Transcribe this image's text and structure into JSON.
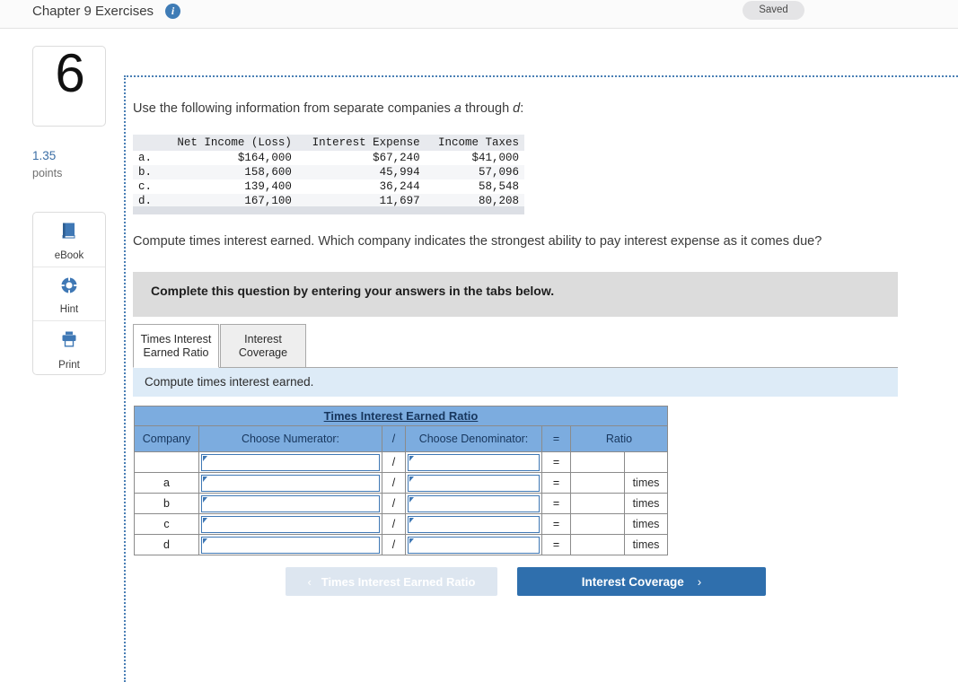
{
  "header": {
    "title": "Chapter 9 Exercises",
    "info_icon": "info-icon",
    "saved_label": "Saved"
  },
  "sidebar": {
    "question_number": "6",
    "points_value": "1.35",
    "points_label": "points",
    "tools": [
      {
        "label": "eBook",
        "icon": "ebook-icon"
      },
      {
        "label": "Hint",
        "icon": "life-preserver-icon"
      },
      {
        "label": "Print",
        "icon": "printer-icon"
      }
    ]
  },
  "content": {
    "intro_pre": "Use the following information from separate companies ",
    "intro_a": "a",
    "intro_mid": " through ",
    "intro_d": "d",
    "intro_post": ":",
    "prompt": "Compute times interest earned. Which company indicates the strongest ability to pay interest expense as it comes due?",
    "instruction": "Complete this question by entering your answers in the tabs below.",
    "subprompt": "Compute times interest earned."
  },
  "data_table": {
    "columns": [
      "",
      "Net Income (Loss)",
      "Interest Expense",
      "Income Taxes"
    ],
    "rows": [
      {
        "label": "a.",
        "net_income": "$164,000",
        "interest_expense": "$67,240",
        "income_taxes": "$41,000"
      },
      {
        "label": "b.",
        "net_income": "158,600",
        "interest_expense": "45,994",
        "income_taxes": "57,096"
      },
      {
        "label": "c.",
        "net_income": "139,400",
        "interest_expense": "36,244",
        "income_taxes": "58,548"
      },
      {
        "label": "d.",
        "net_income": "167,100",
        "interest_expense": "11,697",
        "income_taxes": "80,208"
      }
    ]
  },
  "tabs": [
    {
      "line1": "Times Interest",
      "line2": "Earned Ratio",
      "active": true
    },
    {
      "line1": "Interest",
      "line2": "Coverage",
      "active": false
    }
  ],
  "answer_grid": {
    "title": "Times Interest Earned Ratio",
    "headers": {
      "company": "Company",
      "numerator": "Choose Numerator:",
      "slash": "/",
      "denominator": "Choose Denominator:",
      "equals": "=",
      "ratio": "Ratio"
    },
    "rows": [
      {
        "company": "",
        "numerator": "",
        "denominator": "",
        "ratio": "",
        "unit": ""
      },
      {
        "company": "a",
        "numerator": "",
        "denominator": "",
        "ratio": "",
        "unit": "times"
      },
      {
        "company": "b",
        "numerator": "",
        "denominator": "",
        "ratio": "",
        "unit": "times"
      },
      {
        "company": "c",
        "numerator": "",
        "denominator": "",
        "ratio": "",
        "unit": "times"
      },
      {
        "company": "d",
        "numerator": "",
        "denominator": "",
        "ratio": "",
        "unit": "times"
      }
    ],
    "slash": "/",
    "equals": "="
  },
  "nav": {
    "prev_label": "Times Interest Earned Ratio",
    "prev_chevron": "‹",
    "next_label": "Interest Coverage",
    "next_chevron": "›"
  }
}
